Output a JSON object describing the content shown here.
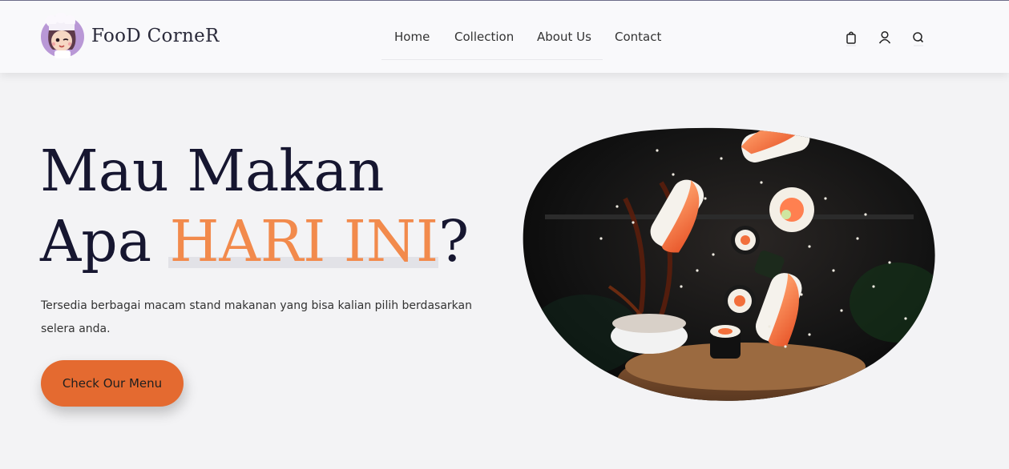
{
  "brand": {
    "name": "FooD CorneR",
    "logo_icon": "chef-mascot-icon"
  },
  "nav": {
    "items": [
      {
        "label": "Home"
      },
      {
        "label": "Collection"
      },
      {
        "label": "About Us"
      },
      {
        "label": "Contact"
      }
    ]
  },
  "header_icons": [
    "shopping-bag-icon",
    "user-icon",
    "search-icon"
  ],
  "hero": {
    "title_line1": "Mau Makan",
    "title_line2_prefix": "Apa ",
    "title_line2_accent": "HARI INI",
    "title_line2_suffix": "?",
    "description": "Tersedia berbagai macam stand makanan yang bisa kalian pilih berdasarkan selera anda.",
    "cta_label": "Check Our Menu",
    "image": "sushi-splash-image"
  },
  "colors": {
    "accent": "#f28a4c",
    "button": "#e46a30",
    "title": "#161630",
    "background": "#f3f3f5"
  }
}
